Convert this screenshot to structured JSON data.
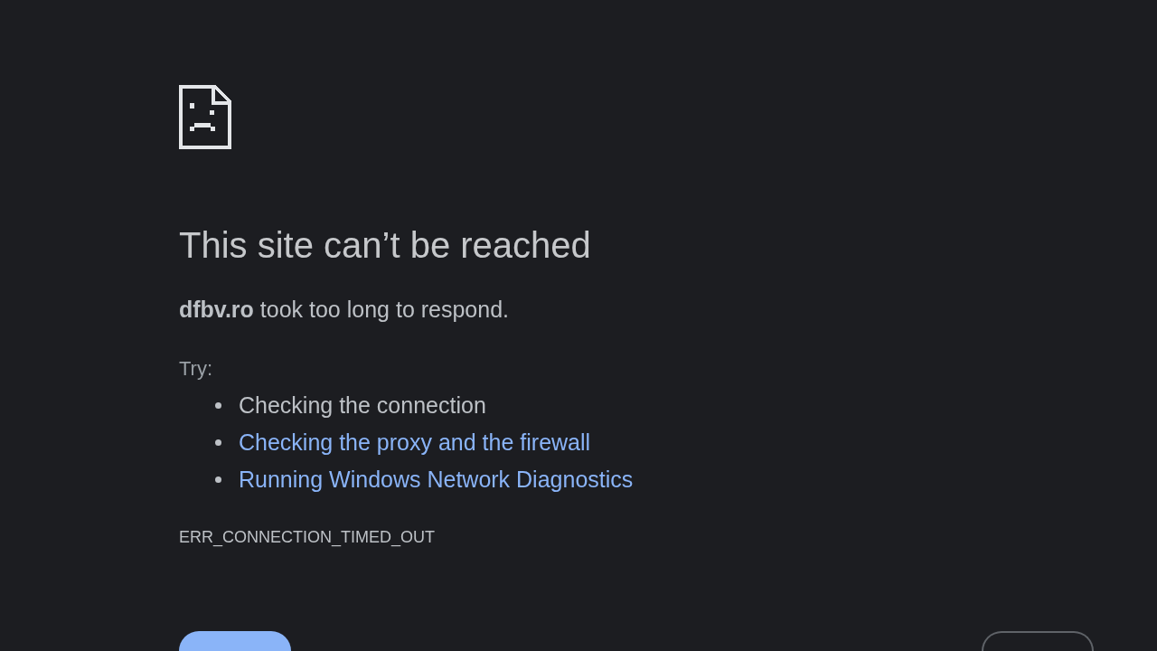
{
  "heading": "This site can’t be reached",
  "summary": "**dfbv.ro** took too long to respond.",
  "suggestions": {
    "label": "Try:",
    "items": [
      {
        "kind": "text",
        "text": "Checking the connection"
      },
      {
        "kind": "link",
        "text": "Checking the proxy and the firewall"
      },
      {
        "kind": "link",
        "text": "Running Windows Network Diagnostics"
      }
    ]
  },
  "error_code": "ERR_CONNECTION_TIMED_OUT",
  "buttons": [
    {
      "kind": "primary"
    },
    {
      "kind": "secondary"
    }
  ]
}
